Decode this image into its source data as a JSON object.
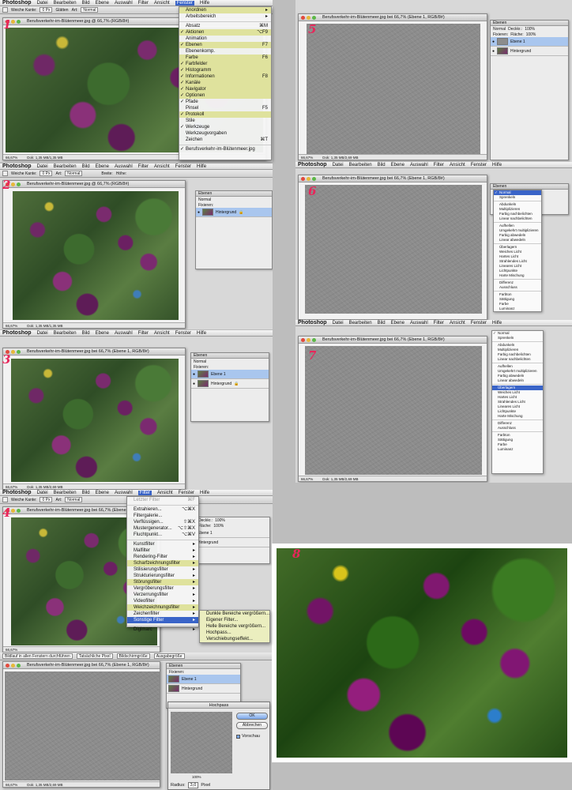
{
  "app_name": "Photoshop",
  "menus": [
    "Datei",
    "Bearbeiten",
    "Bild",
    "Ebene",
    "Auswahl",
    "Filter",
    "Ansicht",
    "Fenster",
    "Hilfe"
  ],
  "file_title_1": "Berufsverkehr-im-Blütenmeer.jpg @ 66,7% (RGB/8#)",
  "file_title_layer": "Berufsverkehr-im-Blütenmeer.jpg bei 66,7% (Ebene 1, RGB/8#)",
  "options": {
    "feather_label": "Weiche Kante:",
    "feather_value": "0 Px",
    "smooth": "Glätten",
    "style_label": "Art:",
    "style_value": "Normal",
    "width_label": "Breite:",
    "height_label": "Höhe:"
  },
  "status": {
    "zoom": "66,67%",
    "doc_1": "Dok: 1,35 MB/1,35 MB",
    "doc_2": "Dok: 1,35 MB/2,69 MB"
  },
  "step_numbers": [
    "1",
    "2",
    "3",
    "4",
    "5",
    "6",
    "7",
    "8"
  ],
  "layers_panel": {
    "tab": "Ebenen",
    "mode": "Normal",
    "opacity_label": "Deckkr.:",
    "opacity": "100%",
    "fill_label": "Fläche:",
    "fill": "100%",
    "lock_label": "Fixieren:",
    "layer1": "Ebene 1",
    "background": "Hintergrund"
  },
  "fenster_menu": {
    "title": "Fenster",
    "items": [
      "Anordnen",
      "Arbeitsbereich",
      "Absatz",
      "Aktionen",
      "Animation",
      "Ebenen",
      "Ebenenkomp.",
      "Farbe",
      "Farbfelder",
      "Histogramm",
      "Informationen",
      "Kanäle",
      "Navigator",
      "Optionen",
      "Pfade",
      "Pinsel",
      "Protokoll",
      "Stile",
      "Werkzeuge",
      "Werkzeugvorgaben",
      "Zeichen",
      "Berufsverkehr-im-Blütenmeer.jpg"
    ],
    "shortcuts": {
      "absatz": "⌘M",
      "aktionen": "⌥F9",
      "ebenen": "F7",
      "farbe": "F6",
      "informationen": "F8",
      "pinsel": "F5",
      "zeichen": "⌘T"
    }
  },
  "filter_menu": {
    "title": "Filter",
    "last_filter": "Letzter Filter",
    "last_sc": "⌘F",
    "items_top": [
      "Extrahieren...",
      "Filtergalerie...",
      "Verflüssigen...",
      "Mustergenerator...",
      "Fluchtpunkt..."
    ],
    "sc_top": [
      "⌥⌘X",
      "",
      "⇧⌘X",
      "⌥⇧⌘X",
      "⌥⌘V"
    ],
    "items_sub": [
      "Kunstfilter",
      "Malfilter",
      "Rendering-Filter",
      "Scharfzeichnungsfilter",
      "Stilisierungsfilter",
      "Strukturierungsfilter",
      "Störungsfilter",
      "Vergröberungsfilter",
      "Verzerrungsfilter",
      "Videofilter",
      "Weichzeichnungsfilter",
      "Zeichenfilter",
      "Sonstige Filter"
    ],
    "digimarc": "Digimarc",
    "sonstige": [
      "Dunkle Bereiche vergrößern...",
      "Eigener Filter...",
      "Helle Bereiche vergrößern...",
      "Hochpass...",
      "Verschiebungseffekt..."
    ]
  },
  "blend_modes": [
    "Normal",
    "Sprenkeln",
    "Abdunkeln",
    "Multiplizieren",
    "Farbig nachbelichten",
    "Linear nachbelichten",
    "Aufhellen",
    "Umgekehrt multiplizieren",
    "Farbig abwedeln",
    "Linear abwedeln",
    "Überlagern",
    "Weiches Licht",
    "Hartes Licht",
    "Strahlendes Licht",
    "Lineares Licht",
    "Lichtpunkte",
    "Harte Mischung",
    "Differenz",
    "Ausschluss",
    "Farbton",
    "Sättigung",
    "Farbe",
    "Luminanz"
  ],
  "hochpass": {
    "title": "Hochpass",
    "ok": "OK",
    "cancel": "Abbrechen",
    "preview": "Vorschau",
    "zoom": "100%",
    "radius_label": "Radius:",
    "radius_value": "3,0",
    "radius_unit": "Pixel"
  },
  "bottom_bar": {
    "fit": "Bildlauf in allen Fenstern durchführen",
    "actual": "Tatsächliche Pixel",
    "screen": "Bildschirmgröße",
    "print": "Ausgabegröße"
  },
  "colors": {
    "highlight": "#3a64c8",
    "menu_yellow": "#dfe29d",
    "step_red": "#e8265a",
    "selected_layer": "#a9c6ee"
  }
}
